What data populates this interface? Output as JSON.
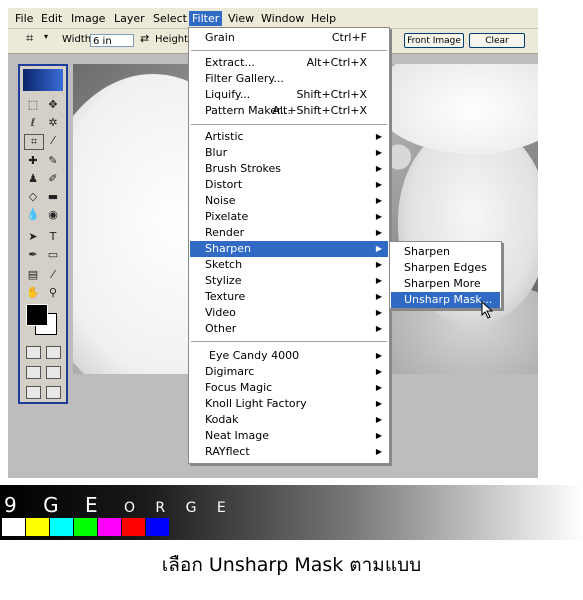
{
  "menubar": {
    "items": [
      "File",
      "Edit",
      "Image",
      "Layer",
      "Select",
      "Filter",
      "View",
      "Window",
      "Help"
    ],
    "active": "Filter"
  },
  "options": {
    "width_label": "Width:",
    "width_value": "6 in",
    "height_label": "Height:",
    "front_image": "Front Image",
    "clear": "Clear"
  },
  "filter_menu": {
    "items": [
      {
        "label": "Grain",
        "shortcut": "Ctrl+F"
      },
      {
        "label": "Extract...",
        "shortcut": "Alt+Ctrl+X"
      },
      {
        "label": "Filter Gallery...",
        "shortcut": ""
      },
      {
        "label": "Liquify...",
        "shortcut": "Shift+Ctrl+X"
      },
      {
        "label": "Pattern Maker...",
        "shortcut": "Alt+Shift+Ctrl+X"
      },
      {
        "label": "Artistic",
        "submenu": true
      },
      {
        "label": "Blur",
        "submenu": true
      },
      {
        "label": "Brush Strokes",
        "submenu": true
      },
      {
        "label": "Distort",
        "submenu": true
      },
      {
        "label": "Noise",
        "submenu": true
      },
      {
        "label": "Pixelate",
        "submenu": true
      },
      {
        "label": "Render",
        "submenu": true
      },
      {
        "label": "Sharpen",
        "submenu": true,
        "highlighted": true
      },
      {
        "label": "Sketch",
        "submenu": true
      },
      {
        "label": "Stylize",
        "submenu": true
      },
      {
        "label": "Texture",
        "submenu": true
      },
      {
        "label": "Video",
        "submenu": true
      },
      {
        "label": "Other",
        "submenu": true
      },
      {
        "label": "Eye Candy 4000",
        "submenu": true
      },
      {
        "label": "Digimarc",
        "submenu": true
      },
      {
        "label": "Focus Magic",
        "submenu": true
      },
      {
        "label": "Knoll Light Factory",
        "submenu": true
      },
      {
        "label": "Kodak",
        "submenu": true
      },
      {
        "label": "Neat Image",
        "submenu": true
      },
      {
        "label": "RAYflect",
        "submenu": true
      }
    ]
  },
  "sharpen_submenu": {
    "items": [
      {
        "label": "Sharpen"
      },
      {
        "label": "Sharpen Edges"
      },
      {
        "label": "Sharpen More"
      },
      {
        "label": "Unsharp Mask...",
        "highlighted": true
      }
    ]
  },
  "banner": {
    "logo_big": "9 G E",
    "logo_small": "O R G E",
    "swatch_colors": [
      "#ffffff",
      "#ffff00",
      "#00ffff",
      "#00ff00",
      "#ff00ff",
      "#ff0000",
      "#0000ff"
    ]
  },
  "caption": "เลือก Unsharp Mask ตามแบบ",
  "colors": {
    "menu_highlight": "#316ac5",
    "toolbox_border": "#1d3c9c"
  }
}
